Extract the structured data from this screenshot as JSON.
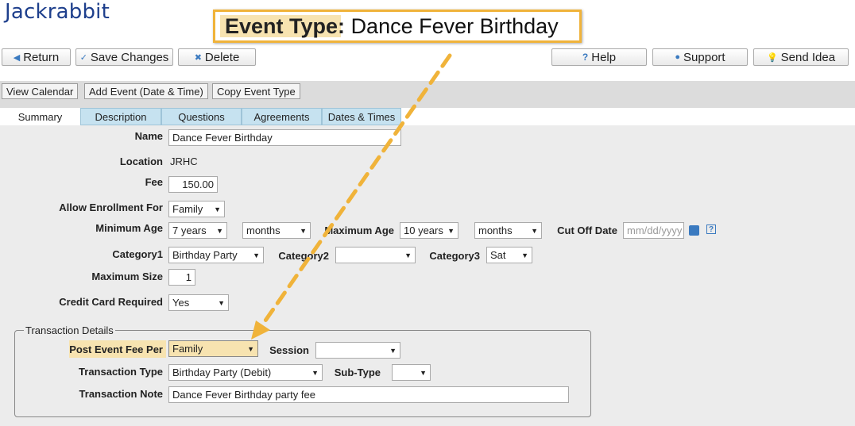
{
  "brand": {
    "logo": "Jackrabbit"
  },
  "callout": {
    "label": "Event Type",
    "colon": ":",
    "value": "Dance Fever Birthday"
  },
  "toolbar": {
    "return": "Return",
    "save": "Save Changes",
    "delete": "Delete",
    "help": "Help",
    "support": "Support",
    "send_idea": "Send Idea"
  },
  "subtoolbar": {
    "view_calendar": "View Calendar",
    "add_event": "Add Event (Date & Time)",
    "copy_event_type": "Copy Event Type"
  },
  "tabs": [
    "Summary",
    "Description",
    "Questions",
    "Agreements",
    "Dates & Times"
  ],
  "form": {
    "name_label": "Name",
    "name_value": "Dance Fever Birthday",
    "location_label": "Location",
    "location_value": "JRHC",
    "fee_label": "Fee",
    "fee_value": "150.00",
    "allow_label": "Allow Enrollment For",
    "allow_value": "Family",
    "min_age_label": "Minimum Age",
    "min_age_years": "7 years",
    "min_age_months": "months",
    "max_age_label": "Maximum Age",
    "max_age_years": "10 years",
    "max_age_months": "months",
    "cutoff_label": "Cut Off Date",
    "cutoff_placeholder": "mm/dd/yyyy",
    "cat1_label": "Category1",
    "cat1_value": "Birthday Party",
    "cat2_label": "Category2",
    "cat2_value": "",
    "cat3_label": "Category3",
    "cat3_value": "Sat",
    "max_size_label": "Maximum Size",
    "max_size_value": "1",
    "cc_label": "Credit Card Required",
    "cc_value": "Yes"
  },
  "transaction": {
    "legend": "Transaction Details",
    "post_fee_label": "Post Event Fee Per",
    "post_fee_value": "Family",
    "session_label": "Session",
    "session_value": "",
    "type_label": "Transaction Type",
    "type_value": "Birthday Party (Debit)",
    "subtype_label": "Sub-Type",
    "subtype_value": "",
    "note_label": "Transaction Note",
    "note_value": "Dance Fever Birthday party fee"
  },
  "colors": {
    "accent": "#f0b33a",
    "highlight": "#f7e3b0",
    "tab": "#c6e2f0",
    "brand": "#1e3f8c"
  }
}
